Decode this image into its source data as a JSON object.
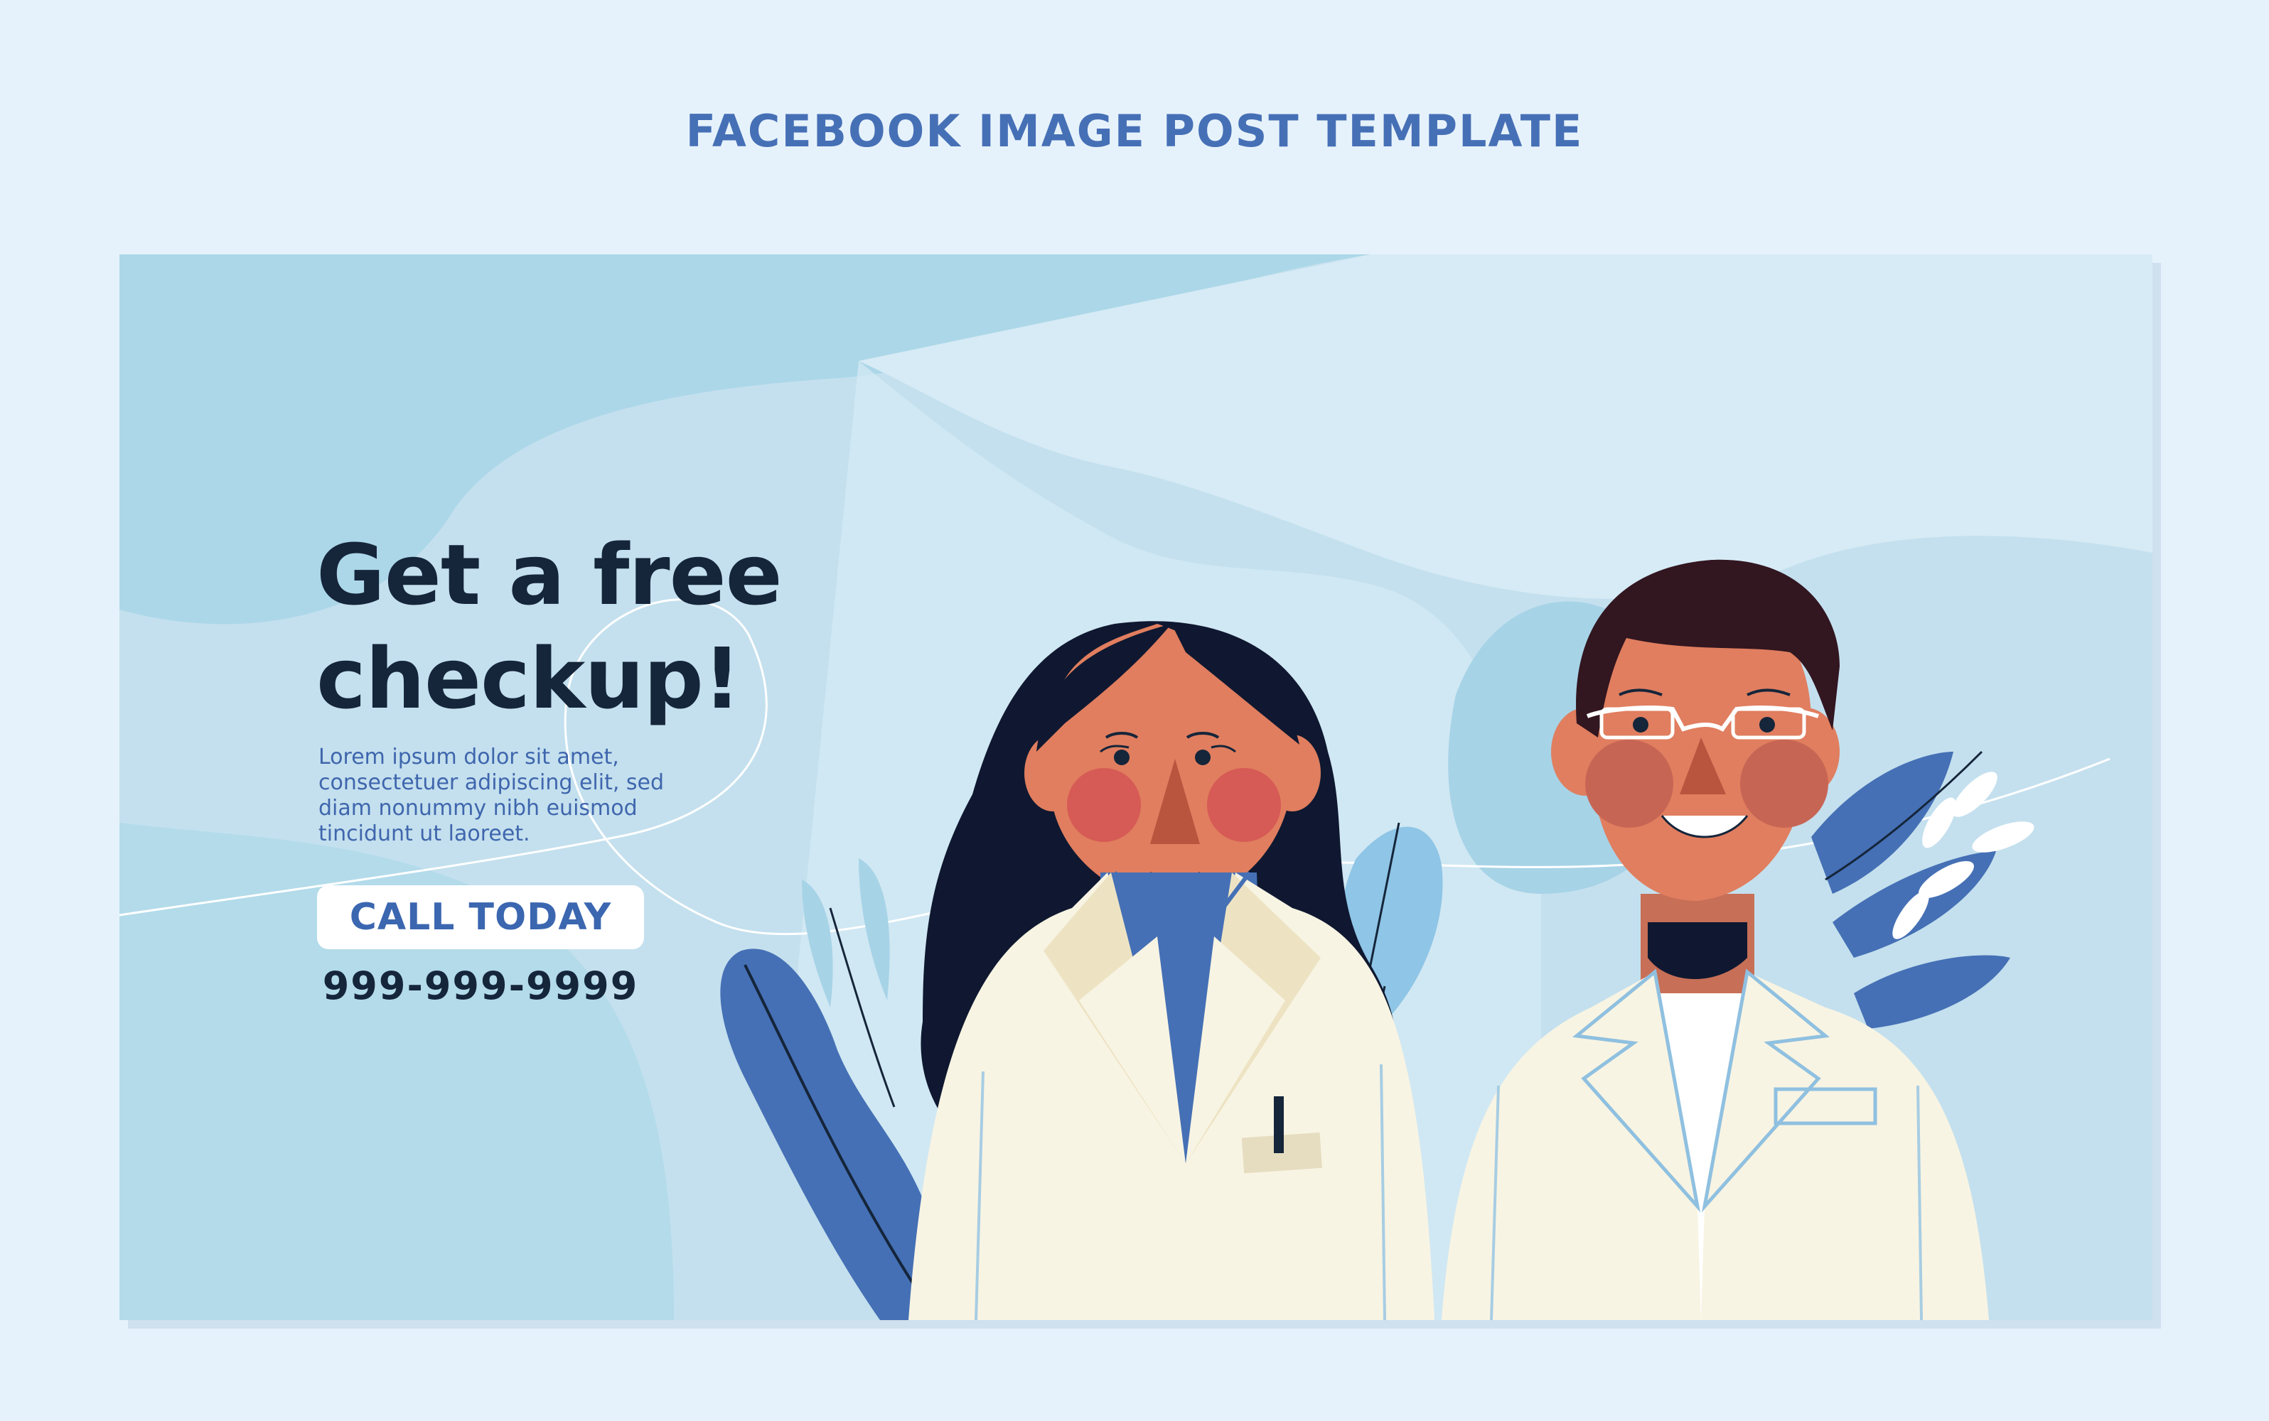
{
  "page": {
    "heading": "FACEBOOK IMAGE POST TEMPLATE"
  },
  "post": {
    "headline_line1": "Get a free",
    "headline_line2": "checkup!",
    "body": "Lorem ipsum dolor sit amet, consectetuer adipiscing elit, sed diam nonummy nibh euismod tincidunt ut laoreet.",
    "cta_label": "CALL TODAY",
    "phone": "999-999-9999"
  },
  "illustration": {
    "subjects": [
      "female-doctor-figure",
      "male-doctor-figure",
      "leaf-decoration"
    ]
  },
  "colors": {
    "page_background": "#e6f2fb",
    "heading": "#4670b6",
    "card_background": "#c4e0ee",
    "headline": "#15253a",
    "body_text": "#3f66ad",
    "cta_text": "#3b66b0",
    "coat": "#f8f4e3",
    "scrub": "#4570b5"
  }
}
